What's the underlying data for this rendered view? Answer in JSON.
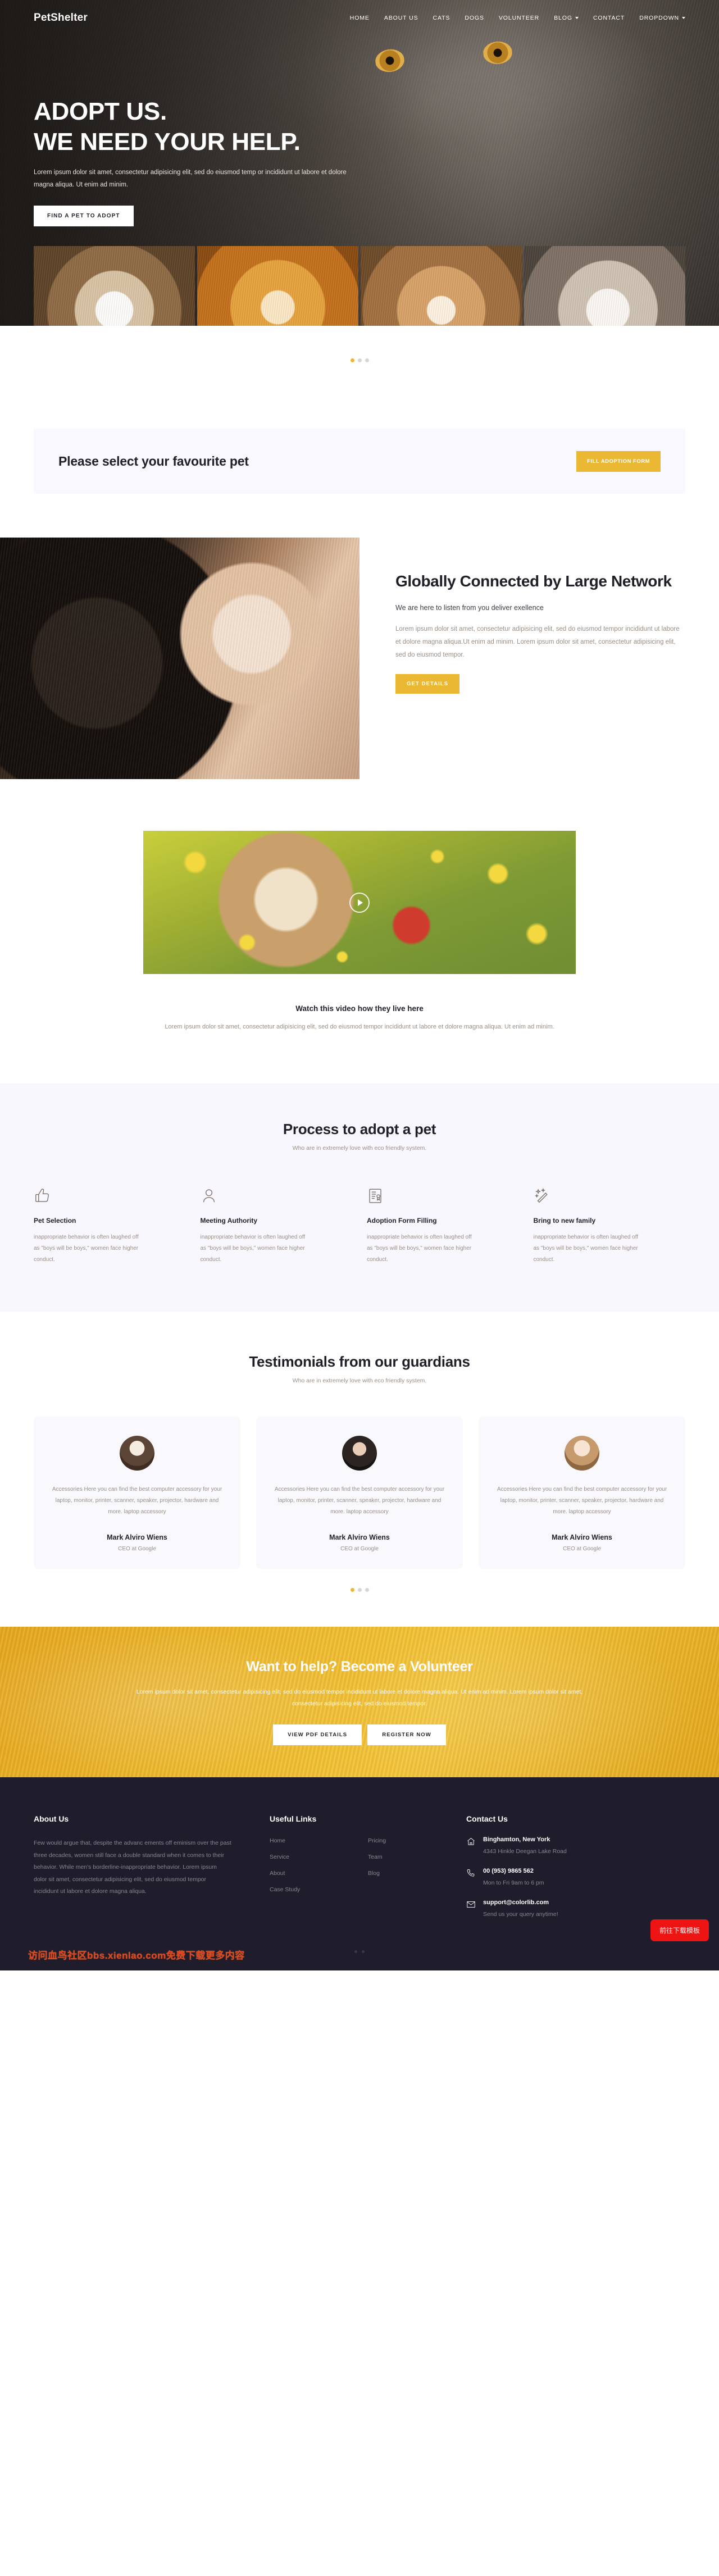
{
  "brand": "PetShelter",
  "nav": {
    "items": [
      {
        "label": "HOME",
        "dropdown": false
      },
      {
        "label": "ABOUT US",
        "dropdown": false
      },
      {
        "label": "CATS",
        "dropdown": false
      },
      {
        "label": "DOGS",
        "dropdown": false
      },
      {
        "label": "VOLUNTEER",
        "dropdown": false
      },
      {
        "label": "BLOG",
        "dropdown": true
      },
      {
        "label": "CONTACT",
        "dropdown": false
      },
      {
        "label": "DROPDOWN",
        "dropdown": true
      }
    ]
  },
  "hero": {
    "title_line1": "ADOPT US.",
    "title_line2": "WE NEED YOUR HELP.",
    "subtitle": "Lorem ipsum dolor sit amet, consectetur adipisicing elit, sed do eiusmod temp or incididunt ut labore et dolore magna aliqua. Ut enim ad minim.",
    "cta_label": "FIND A PET TO ADOPT",
    "slider_dots": 3,
    "slider_active": 0
  },
  "select_bar": {
    "title": "Please select your favourite pet",
    "button_label": "Fill Adoption Form"
  },
  "global": {
    "title": "Globally Connected by Large Network",
    "lead": "We are here to listen from you deliver exellence",
    "body": "Lorem ipsum dolor sit amet, consectetur adipisicing elit, sed do eiusmod tempor incididunt ut labore et dolore magna aliqua.Ut enim ad minim. Lorem ipsum dolor sit amet, consectetur adipisicing elit, sed do eiusmod tempor.",
    "button_label": "GET DETAILS"
  },
  "video": {
    "title": "Watch this video how they live here",
    "description": "Lorem ipsum dolor sit amet, consectetur adipisicing elit, sed do eiusmod tempor incididunt ut labore et dolore magna aliqua. Ut enim ad minim.",
    "play_icon": "play-icon"
  },
  "process": {
    "title": "Process to adopt a pet",
    "subtitle": "Who are in extremely love with eco friendly system.",
    "features": [
      {
        "icon": "thumbs-up-icon",
        "title": "Pet Selection",
        "text": "inappropriate behavior is often laughed off as \"boys will be boys,\" women face higher conduct."
      },
      {
        "icon": "user-icon",
        "title": "Meeting Authority",
        "text": "inappropriate behavior is often laughed off as \"boys will be boys,\" women face higher conduct."
      },
      {
        "icon": "certificate-icon",
        "title": "Adoption Form Filling",
        "text": "inappropriate behavior is often laughed off as \"boys will be boys,\" women face higher conduct."
      },
      {
        "icon": "magic-wand-icon",
        "title": "Bring to new family",
        "text": "inappropriate behavior is often laughed off as \"boys will be boys,\" women face higher conduct."
      }
    ]
  },
  "testimonials": {
    "title": "Testimonials from our guardians",
    "subtitle": "Who are in extremely love with eco friendly system.",
    "cards": [
      {
        "avatar": "avatar-1",
        "quote": "Accessories Here you can find the best computer accessory for your laptop, monitor, printer, scanner, speaker, projector, hardware and more. laptop accessory",
        "name": "Mark Alviro Wiens",
        "role": "CEO at Google"
      },
      {
        "avatar": "avatar-2",
        "quote": "Accessories Here you can find the best computer accessory for your laptop, monitor, printer, scanner, speaker, projector, hardware and more. laptop accessory",
        "name": "Mark Alviro Wiens",
        "role": "CEO at Google"
      },
      {
        "avatar": "avatar-3",
        "quote": "Accessories Here you can find the best computer accessory for your laptop, monitor, printer, scanner, speaker, projector, hardware and more. laptop accessory",
        "name": "Mark Alviro Wiens",
        "role": "CEO at Google"
      }
    ],
    "slider_dots": 3,
    "slider_active": 0
  },
  "cta": {
    "title": "Want to help? Become a Volunteer",
    "text": "Lorem ipsum dolor sit amet, consectetur adipisicing elit, sed do eiusmod tempor incididunt ut labore et dolore magna aliqua. Ut enim ad minim. Lorem ipsum dolor sit amet, consectetur adipisicing elit, sed do eiusmod tempor.",
    "buttons": [
      {
        "label": "VIEW PDF DETAILS"
      },
      {
        "label": "REGISTER NOW"
      }
    ]
  },
  "footer": {
    "about": {
      "title": "About Us",
      "text": "Few would argue that, despite the advanc ements off eminism over the past three decades, women still face a double standard when it comes to their behavior. While men's borderline-inappropriate behavior. Lorem ipsum dolor sit amet, consectetur adipisicing elit, sed do eiusmod tempor incididunt ut labore et dolore magna aliqua."
    },
    "links": {
      "title": "Useful Links",
      "col1": [
        "Home",
        "Service",
        "About",
        "Case Study"
      ],
      "col2": [
        "Pricing",
        "Team",
        "Blog"
      ]
    },
    "contact": {
      "title": "Contact Us",
      "rows": [
        {
          "icon": "home-icon",
          "main": "Binghamton, New York",
          "sub": "4343 Hinkle Deegan Lake Road"
        },
        {
          "icon": "phone-icon",
          "main": "00 (953) 9865 562",
          "sub": "Mon to Fri 9am to 6 pm"
        },
        {
          "icon": "mail-icon",
          "main": "support@colorlib.com",
          "sub": "Send us your query anytime!"
        }
      ]
    },
    "watermark": "访问血鸟社区bbs.xienlao.com免费下载更多内容",
    "download_button": "前往下载模板"
  },
  "colors": {
    "accent_yellow": "#eab832",
    "cta_yellow": "#f0bb2d",
    "footer_dark": "#1f1d2b",
    "light_panel": "#f8f7fd",
    "muted_text": "#9b8f85",
    "download_red": "#ee1414"
  }
}
